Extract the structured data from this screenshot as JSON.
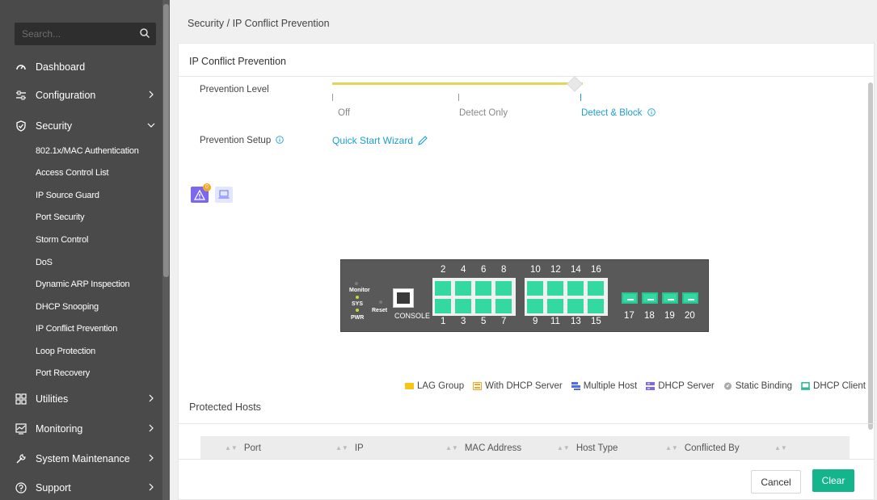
{
  "sidebar": {
    "search_placeholder": "Search...",
    "items": [
      {
        "label": "Dashboard",
        "icon": "dashboard-icon"
      },
      {
        "label": "Configuration",
        "icon": "sliders-icon"
      },
      {
        "label": "Security",
        "icon": "shield-icon"
      },
      {
        "label": "Utilities",
        "icon": "grid-icon"
      },
      {
        "label": "Monitoring",
        "icon": "monitor-icon"
      },
      {
        "label": "System Maintenance",
        "icon": "wrench-icon"
      },
      {
        "label": "Support",
        "icon": "help-icon"
      }
    ],
    "security_sub": [
      "802.1x/MAC Authentication",
      "Access Control List",
      "IP Source Guard",
      "Port Security",
      "Storm Control",
      "DoS",
      "Dynamic ARP Inspection",
      "DHCP Snooping",
      "IP Conflict Prevention",
      "Loop Protection",
      "Port Recovery"
    ]
  },
  "breadcrumb": "Security / IP Conflict Prevention",
  "panel": {
    "title": "IP Conflict Prevention",
    "prevention_level_label": "Prevention Level",
    "levels": [
      "Off",
      "Detect Only",
      "Detect & Block"
    ],
    "selected_level": "Detect & Block",
    "prevention_setup_label": "Prevention Setup",
    "wizard_link": "Quick Start Wizard",
    "warning_count": "0"
  },
  "switch": {
    "top_ports": [
      "2",
      "4",
      "6",
      "8",
      "10",
      "12",
      "14",
      "16"
    ],
    "bottom_ports": [
      "1",
      "3",
      "5",
      "7",
      "9",
      "11",
      "13",
      "15"
    ],
    "sfp_ports": [
      "17",
      "18",
      "19",
      "20"
    ],
    "labels": {
      "monitor": "Monitor",
      "sys": "SYS",
      "pwr": "PWR",
      "reset": "Reset",
      "console": "CONSOLE"
    }
  },
  "legend": [
    "LAG Group",
    "With DHCP Server",
    "Multiple Host",
    "DHCP Server",
    "Static Binding",
    "DHCP Client"
  ],
  "legend_colors": {
    "lag": "#f5c518",
    "with_dhcp": "#f5a623",
    "multiple_host": "#4a6cf7",
    "dhcp_server": "#7b68ee",
    "static": "#aaaaaa",
    "dhcp_client": "#14b48c"
  },
  "protected_hosts": {
    "title": "Protected Hosts",
    "columns": [
      "Port",
      "IP",
      "MAC Address",
      "Host Type",
      "Conflicted By"
    ]
  },
  "buttons": {
    "cancel": "Cancel",
    "clear": "Clear"
  }
}
